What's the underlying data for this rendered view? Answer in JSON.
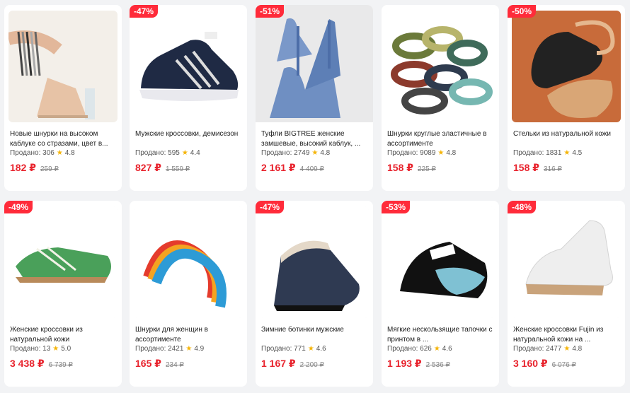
{
  "products": [
    {
      "badge": "",
      "title": "Новые шнурки на высоком каблуке со стразами, цвет в...",
      "sold_label": "Продано: 306",
      "rating": "4.8",
      "price": "182 ₽",
      "old_price": "259 ₽",
      "icon": "sandal-heel-icon"
    },
    {
      "badge": "-47%",
      "title": "Мужские кроссовки, демисезон",
      "sold_label": "Продано: 595",
      "rating": "4.4",
      "price": "827 ₽",
      "old_price": "1 559 ₽",
      "icon": "sneaker-icon"
    },
    {
      "badge": "-51%",
      "title": "Туфли BIGTREE женские замшевые, высокий каблук, ...",
      "sold_label": "Продано: 2749",
      "rating": "4.8",
      "price": "2 161 ₽",
      "old_price": "4 409 ₽",
      "icon": "high-heel-icon"
    },
    {
      "badge": "",
      "title": "Шнурки круглые эластичные в ассортименте",
      "sold_label": "Продано: 9089",
      "rating": "4.8",
      "price": "158 ₽",
      "old_price": "225 ₽",
      "icon": "laces-bundle-icon"
    },
    {
      "badge": "-50%",
      "title": "Стельки из натуральной кожи",
      "sold_label": "Продано: 1831",
      "rating": "4.5",
      "price": "158 ₽",
      "old_price": "316 ₽",
      "icon": "insole-icon"
    },
    {
      "badge": "-49%",
      "title": "Женские кроссовки из натуральной кожи",
      "sold_label": "Продано: 13",
      "rating": "5.0",
      "price": "3 438 ₽",
      "old_price": "6 739 ₽",
      "icon": "green-sneaker-icon"
    },
    {
      "badge": "",
      "title": "Шнурки для женщин в ассортименте",
      "sold_label": "Продано: 2421",
      "rating": "4.9",
      "price": "165 ₽",
      "old_price": "234 ₽",
      "icon": "rainbow-lace-icon"
    },
    {
      "badge": "-47%",
      "title": "Зимние ботинки мужские",
      "sold_label": "Продано: 771",
      "rating": "4.6",
      "price": "1 167 ₽",
      "old_price": "2 200 ₽",
      "icon": "winter-boot-icon"
    },
    {
      "badge": "-53%",
      "title": "Мягкие нескользящие тапочки с принтом в ...",
      "sold_label": "Продано: 626",
      "rating": "4.6",
      "price": "1 193 ₽",
      "old_price": "2 536 ₽",
      "icon": "slipper-icon"
    },
    {
      "badge": "-48%",
      "title": "Женские кроссовки Fujin из натуральной кожи на ...",
      "sold_label": "Продано: 2477",
      "rating": "4.8",
      "price": "3 160 ₽",
      "old_price": "6 076 ₽",
      "icon": "white-sneaker-icon"
    }
  ],
  "colors": {
    "accent": "#e8232d",
    "badge": "#ff2b3a",
    "star": "#f5b50a"
  }
}
